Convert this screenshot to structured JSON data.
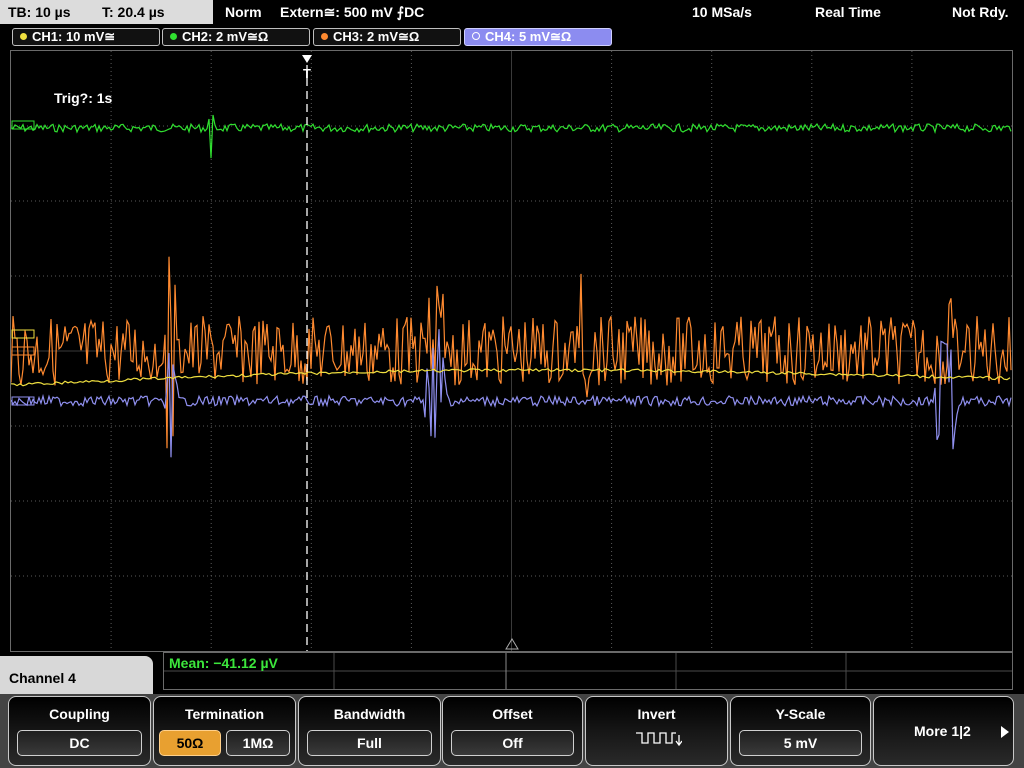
{
  "status": {
    "timebase": "TB: 10 µs",
    "trigger_time": "T: 20.4 µs",
    "acq_mode": "Norm",
    "trigger_source": "Extern≅: 500 mV ⨍DC",
    "sample_rate": "10 MSa/s",
    "time_mode": "Real Time",
    "state": "Not Rdy."
  },
  "channels": [
    {
      "label": "CH1: 10 mV≅",
      "color": "#f0e040"
    },
    {
      "label": "CH2: 2 mV≅Ω",
      "color": "#30e030"
    },
    {
      "label": "CH3: 2 mV≅Ω",
      "color": "#ff8a30"
    },
    {
      "label": "CH4: 5 mV≅Ω",
      "color": "#9090f0"
    }
  ],
  "screen": {
    "trigger_status": "Trig?: 1s",
    "trigger_marker": "T"
  },
  "measurement": {
    "mean": "Mean: −41.12 µV"
  },
  "menu": {
    "title": "Channel 4",
    "coupling": {
      "title": "Coupling",
      "value": "DC"
    },
    "termination": {
      "title": "Termination",
      "opt1": "50Ω",
      "opt2": "1MΩ"
    },
    "bandwidth": {
      "title": "Bandwidth",
      "value": "Full"
    },
    "offset": {
      "title": "Offset",
      "value": "Off"
    },
    "invert": {
      "title": "Invert"
    },
    "yscale": {
      "title": "Y-Scale",
      "value": "5 mV"
    },
    "more": {
      "label": "More 1|2"
    }
  },
  "colors": {
    "grid": "#5a5a5a",
    "accent": "#e8a030"
  }
}
